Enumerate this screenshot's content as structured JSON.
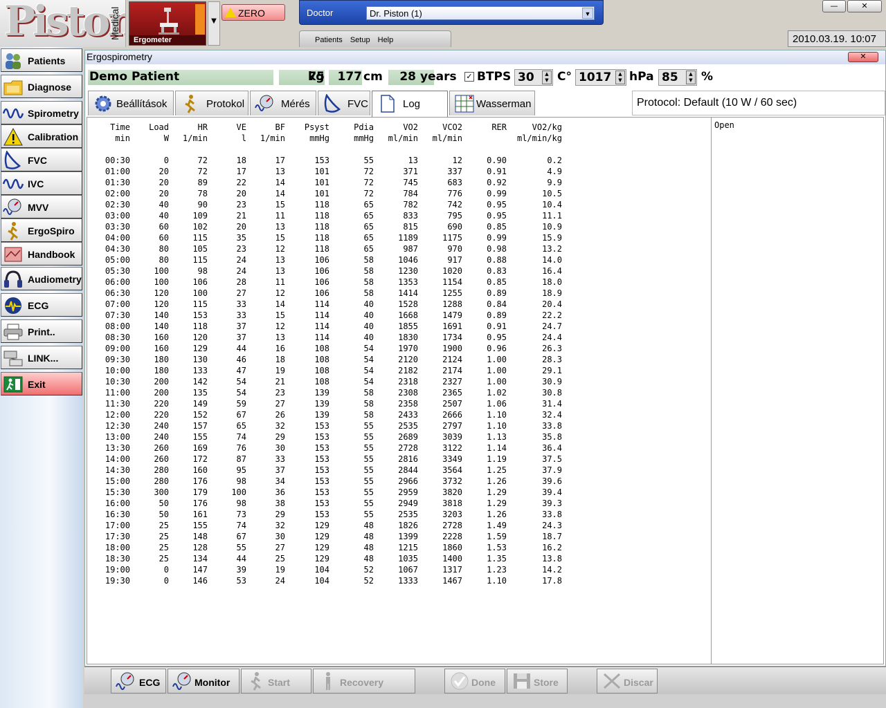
{
  "app": {
    "logo_text": "Piston",
    "logo_sub": "Medical",
    "device_label": "Ergometer",
    "zero_label": "ZERO",
    "doctor_label": "Doctor",
    "doctor_value": "Dr. Piston (1)",
    "menu": [
      "Patients",
      "Setup",
      "Help"
    ],
    "datetime": "2010.03.19. 10:07",
    "window_buttons": {
      "minimize": "—",
      "close": "✕"
    }
  },
  "sidebar": {
    "items": [
      {
        "label": "Patients",
        "icon": "patients-icon"
      },
      {
        "label": "Diagnose",
        "icon": "folder-icon"
      },
      {
        "label": "Spirometry",
        "icon": "wave-icon"
      },
      {
        "label": "Calibration",
        "icon": "warning-icon"
      },
      {
        "label": "FVC",
        "icon": "fvc-loop-icon"
      },
      {
        "label": "IVC",
        "icon": "wave-icon"
      },
      {
        "label": "MVV",
        "icon": "gauge-icon"
      },
      {
        "label": "ErgoSpiro",
        "icon": "runner-icon"
      },
      {
        "label": "Handbook",
        "icon": "handbook-icon"
      },
      {
        "label": "Audiometry",
        "icon": "headphones-icon"
      },
      {
        "label": "ECG",
        "icon": "ecg-icon"
      },
      {
        "label": "Print..",
        "icon": "printer-icon"
      },
      {
        "label": "LINK...",
        "icon": "network-icon"
      },
      {
        "label": "Exit",
        "icon": "exit-icon"
      }
    ]
  },
  "main": {
    "title": "Ergospirometry",
    "close": "✕",
    "patient": {
      "name": "Demo Patient",
      "weight": "75",
      "weight_unit": "kg",
      "height": "177",
      "height_unit": "cm",
      "age": "28",
      "age_unit": "years",
      "btps_label": "BTPS",
      "btps_checked": true,
      "temp": "30",
      "temp_unit": "C°",
      "pressure": "1017",
      "pressure_unit": "hPa",
      "humidity": "85",
      "humidity_unit": "%"
    },
    "tabs": [
      {
        "label": "Beállítások",
        "icon": "gear-icon"
      },
      {
        "label": "Protokol",
        "icon": "runner-icon"
      },
      {
        "label": "Mérés",
        "icon": "gauge-icon"
      },
      {
        "label": "FVC",
        "icon": "fvc-loop-icon"
      },
      {
        "label": "Log",
        "icon": "document-icon",
        "active": true
      },
      {
        "label": "Wasserman",
        "icon": "grid-chart-icon"
      }
    ],
    "protocol_text": "Protocol: Default (10 W / 60 sec)",
    "open_label": "Open",
    "log": {
      "headers": [
        "Time",
        "Load",
        "HR",
        "VE",
        "BF",
        "Psyst",
        "Pdia",
        "VO2",
        "VCO2",
        "RER",
        "VO2/kg"
      ],
      "units": [
        "min",
        "W",
        "1/min",
        "l",
        "1/min",
        "mmHg",
        "mmHg",
        "ml/min",
        "ml/min",
        "",
        "ml/min/kg"
      ],
      "rows": [
        [
          "00:30",
          "0",
          "72",
          "18",
          "17",
          "153",
          "55",
          "13",
          "12",
          "0.90",
          "0.2"
        ],
        [
          "01:00",
          "20",
          "72",
          "17",
          "13",
          "101",
          "72",
          "371",
          "337",
          "0.91",
          "4.9"
        ],
        [
          "01:30",
          "20",
          "89",
          "22",
          "14",
          "101",
          "72",
          "745",
          "683",
          "0.92",
          "9.9"
        ],
        [
          "02:00",
          "20",
          "78",
          "20",
          "14",
          "101",
          "72",
          "784",
          "776",
          "0.99",
          "10.5"
        ],
        [
          "02:30",
          "40",
          "90",
          "23",
          "15",
          "118",
          "65",
          "782",
          "742",
          "0.95",
          "10.4"
        ],
        [
          "03:00",
          "40",
          "109",
          "21",
          "11",
          "118",
          "65",
          "833",
          "795",
          "0.95",
          "11.1"
        ],
        [
          "03:30",
          "60",
          "102",
          "20",
          "13",
          "118",
          "65",
          "815",
          "690",
          "0.85",
          "10.9"
        ],
        [
          "04:00",
          "60",
          "115",
          "35",
          "15",
          "118",
          "65",
          "1189",
          "1175",
          "0.99",
          "15.9"
        ],
        [
          "04:30",
          "80",
          "105",
          "23",
          "12",
          "118",
          "65",
          "987",
          "970",
          "0.98",
          "13.2"
        ],
        [
          "05:00",
          "80",
          "115",
          "24",
          "13",
          "106",
          "58",
          "1046",
          "917",
          "0.88",
          "14.0"
        ],
        [
          "05:30",
          "100",
          "98",
          "24",
          "13",
          "106",
          "58",
          "1230",
          "1020",
          "0.83",
          "16.4"
        ],
        [
          "06:00",
          "100",
          "106",
          "28",
          "11",
          "106",
          "58",
          "1353",
          "1154",
          "0.85",
          "18.0"
        ],
        [
          "06:30",
          "120",
          "100",
          "27",
          "12",
          "106",
          "58",
          "1414",
          "1255",
          "0.89",
          "18.9"
        ],
        [
          "07:00",
          "120",
          "115",
          "33",
          "14",
          "114",
          "40",
          "1528",
          "1288",
          "0.84",
          "20.4"
        ],
        [
          "07:30",
          "140",
          "153",
          "33",
          "15",
          "114",
          "40",
          "1668",
          "1479",
          "0.89",
          "22.2"
        ],
        [
          "08:00",
          "140",
          "118",
          "37",
          "12",
          "114",
          "40",
          "1855",
          "1691",
          "0.91",
          "24.7"
        ],
        [
          "08:30",
          "160",
          "120",
          "37",
          "13",
          "114",
          "40",
          "1830",
          "1734",
          "0.95",
          "24.4"
        ],
        [
          "09:00",
          "160",
          "129",
          "44",
          "16",
          "108",
          "54",
          "1970",
          "1900",
          "0.96",
          "26.3"
        ],
        [
          "09:30",
          "180",
          "130",
          "46",
          "18",
          "108",
          "54",
          "2120",
          "2124",
          "1.00",
          "28.3"
        ],
        [
          "10:00",
          "180",
          "133",
          "47",
          "19",
          "108",
          "54",
          "2182",
          "2174",
          "1.00",
          "29.1"
        ],
        [
          "10:30",
          "200",
          "142",
          "54",
          "21",
          "108",
          "54",
          "2318",
          "2327",
          "1.00",
          "30.9"
        ],
        [
          "11:00",
          "200",
          "135",
          "54",
          "23",
          "139",
          "58",
          "2308",
          "2365",
          "1.02",
          "30.8"
        ],
        [
          "11:30",
          "220",
          "149",
          "59",
          "27",
          "139",
          "58",
          "2358",
          "2507",
          "1.06",
          "31.4"
        ],
        [
          "12:00",
          "220",
          "152",
          "67",
          "26",
          "139",
          "58",
          "2433",
          "2666",
          "1.10",
          "32.4"
        ],
        [
          "12:30",
          "240",
          "157",
          "65",
          "32",
          "153",
          "55",
          "2535",
          "2797",
          "1.10",
          "33.8"
        ],
        [
          "13:00",
          "240",
          "155",
          "74",
          "29",
          "153",
          "55",
          "2689",
          "3039",
          "1.13",
          "35.8"
        ],
        [
          "13:30",
          "260",
          "169",
          "76",
          "30",
          "153",
          "55",
          "2728",
          "3122",
          "1.14",
          "36.4"
        ],
        [
          "14:00",
          "260",
          "172",
          "87",
          "33",
          "153",
          "55",
          "2816",
          "3349",
          "1.19",
          "37.5"
        ],
        [
          "14:30",
          "280",
          "160",
          "95",
          "37",
          "153",
          "55",
          "2844",
          "3564",
          "1.25",
          "37.9"
        ],
        [
          "15:00",
          "280",
          "176",
          "98",
          "34",
          "153",
          "55",
          "2966",
          "3732",
          "1.26",
          "39.6"
        ],
        [
          "15:30",
          "300",
          "179",
          "100",
          "36",
          "153",
          "55",
          "2959",
          "3820",
          "1.29",
          "39.4"
        ],
        [
          "16:00",
          "50",
          "176",
          "98",
          "38",
          "153",
          "55",
          "2949",
          "3818",
          "1.29",
          "39.3"
        ],
        [
          "16:30",
          "50",
          "161",
          "73",
          "29",
          "153",
          "55",
          "2535",
          "3203",
          "1.26",
          "33.8"
        ],
        [
          "17:00",
          "25",
          "155",
          "74",
          "32",
          "129",
          "48",
          "1826",
          "2728",
          "1.49",
          "24.3"
        ],
        [
          "17:30",
          "25",
          "148",
          "67",
          "30",
          "129",
          "48",
          "1399",
          "2228",
          "1.59",
          "18.7"
        ],
        [
          "18:00",
          "25",
          "128",
          "55",
          "27",
          "129",
          "48",
          "1215",
          "1860",
          "1.53",
          "16.2"
        ],
        [
          "18:30",
          "25",
          "134",
          "44",
          "25",
          "129",
          "48",
          "1035",
          "1400",
          "1.35",
          "13.8"
        ],
        [
          "19:00",
          "0",
          "147",
          "39",
          "19",
          "104",
          "52",
          "1067",
          "1317",
          "1.23",
          "14.2"
        ],
        [
          "19:30",
          "0",
          "146",
          "53",
          "24",
          "104",
          "52",
          "1333",
          "1467",
          "1.10",
          "17.8"
        ]
      ]
    }
  },
  "toolbar": {
    "buttons": [
      {
        "label": "ECG",
        "icon": "ecg-gauge-icon",
        "enabled": true
      },
      {
        "label": "Monitor",
        "icon": "gauge-icon",
        "enabled": true
      },
      {
        "label": "Start",
        "icon": "runner-icon",
        "enabled": false
      },
      {
        "label": "Recovery",
        "icon": "standing-person-icon",
        "enabled": false
      },
      {
        "label": "Done",
        "icon": "check-icon",
        "enabled": false
      },
      {
        "label": "Store",
        "icon": "floppy-icon",
        "enabled": false
      },
      {
        "label": "Discar",
        "icon": "discard-icon",
        "enabled": false
      }
    ]
  }
}
